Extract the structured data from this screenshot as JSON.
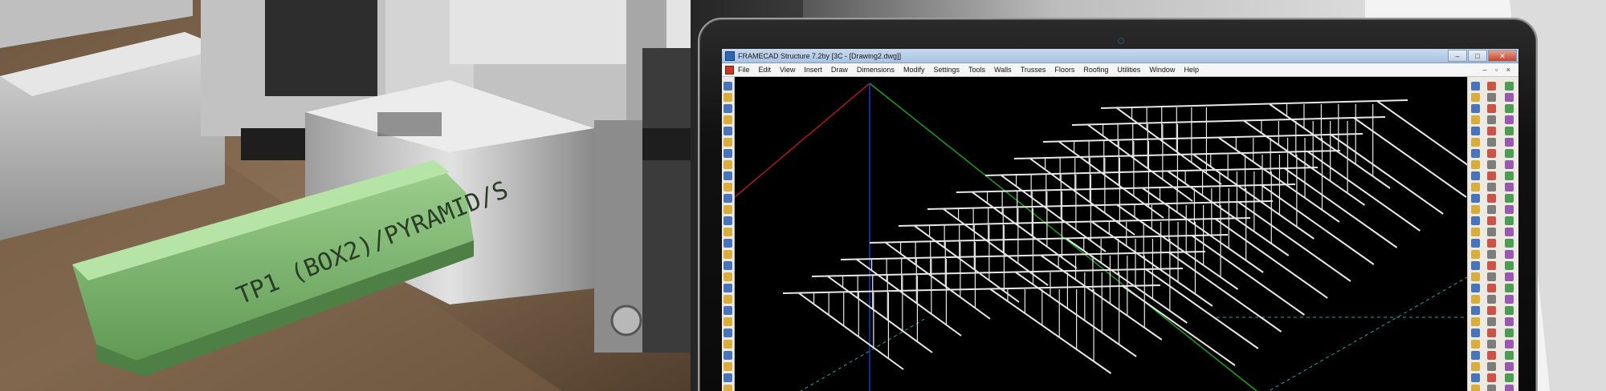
{
  "window": {
    "title": "FRAMECAD Structure 7.2by [3C - [Drawing2.dwg]]",
    "controls": [
      "–",
      "□",
      "✕"
    ]
  },
  "menu": [
    "File",
    "Edit",
    "View",
    "Insert",
    "Draw",
    "Dimensions",
    "Modify",
    "Settings",
    "Tools",
    "Walls",
    "Trusses",
    "Floors",
    "Roofing",
    "Utilities",
    "Window",
    "Help"
  ],
  "mdi_controls": "– ▫ ×",
  "profile_label": "TP1 (BOX2)/PYRAMID/S",
  "icons": {
    "app": "framecad-app-icon",
    "document": "drawing-document-icon"
  },
  "colors": {
    "viewport_bg": "#000000",
    "truss": "#e8e8e8",
    "axis_x": "#b01818",
    "axis_y": "#1aa21a",
    "axis_z": "#2233cc",
    "guide": "#1fa8a8",
    "steel_profile": "#74b06b"
  }
}
